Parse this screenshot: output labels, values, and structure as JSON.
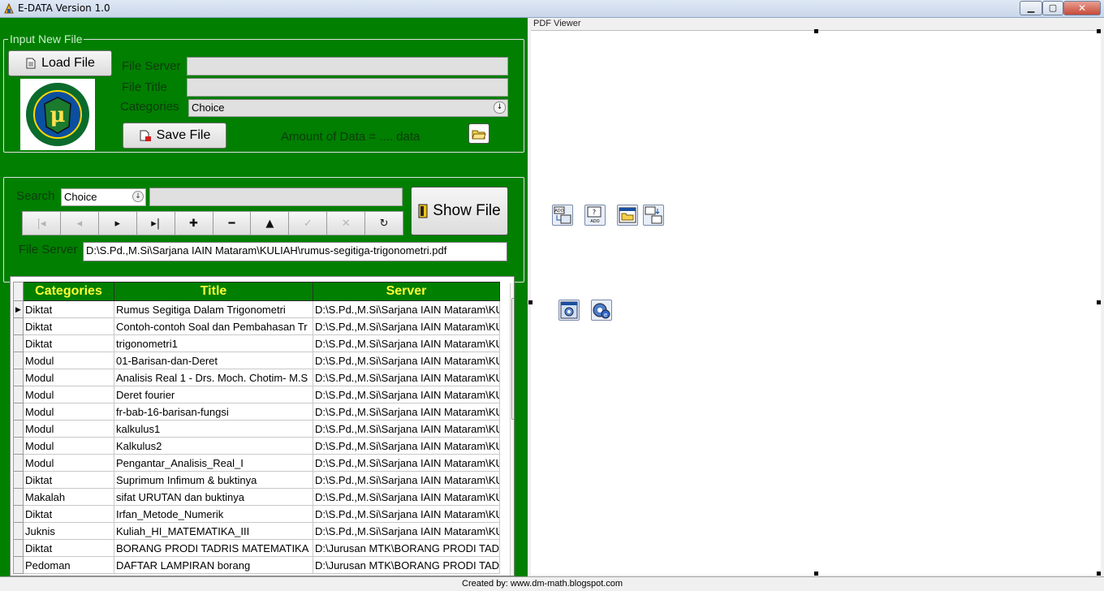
{
  "window": {
    "title": "E-DATA Version 1.0",
    "min_glyph": "▁",
    "max_glyph": "▢",
    "close_glyph": "✕"
  },
  "input_group": {
    "legend": "Input New File",
    "load_button": "Load File",
    "file_server_label": "File Server",
    "file_server_value": "",
    "file_title_label": "File Title",
    "file_title_value": "",
    "categories_label": "Categories",
    "categories_value": "Choice",
    "save_button": "Save File",
    "amount_text": "Amount of Data = .... data"
  },
  "search_group": {
    "search_label": "Search",
    "search_combo_value": "Choice",
    "search_input_value": "",
    "show_button": "Show File",
    "file_server_label": "File Server",
    "file_server_value": "D:\\S.Pd.,M.Si\\Sarjana IAIN Mataram\\KULIAH\\rumus-segitiga-trigonometri.pdf",
    "nav_buttons": [
      {
        "name": "first",
        "glyph": "|◂",
        "enabled": false
      },
      {
        "name": "prior",
        "glyph": "◂",
        "enabled": false
      },
      {
        "name": "next",
        "glyph": "▸",
        "enabled": true
      },
      {
        "name": "last",
        "glyph": "▸|",
        "enabled": true
      },
      {
        "name": "insert",
        "glyph": "✚",
        "enabled": true
      },
      {
        "name": "delete",
        "glyph": "━",
        "enabled": true
      },
      {
        "name": "edit",
        "glyph": "▲",
        "enabled": true
      },
      {
        "name": "post",
        "glyph": "✓",
        "enabled": false
      },
      {
        "name": "cancel",
        "glyph": "✕",
        "enabled": false
      },
      {
        "name": "refresh",
        "glyph": "↻",
        "enabled": true
      }
    ]
  },
  "grid": {
    "columns": [
      "Categories",
      "Title",
      "Server"
    ],
    "rows": [
      [
        "Diktat",
        "Rumus Segitiga Dalam Trigonometri",
        "D:\\S.Pd.,M.Si\\Sarjana IAIN Mataram\\KU"
      ],
      [
        "Diktat",
        "Contoh-contoh Soal dan Pembahasan Tr",
        "D:\\S.Pd.,M.Si\\Sarjana IAIN Mataram\\KU"
      ],
      [
        "Diktat",
        "trigonometri1",
        "D:\\S.Pd.,M.Si\\Sarjana IAIN Mataram\\KU"
      ],
      [
        "Modul",
        "01-Barisan-dan-Deret",
        "D:\\S.Pd.,M.Si\\Sarjana IAIN Mataram\\KU"
      ],
      [
        "Modul",
        "Analisis Real 1 - Drs. Moch. Chotim- M.S",
        "D:\\S.Pd.,M.Si\\Sarjana IAIN Mataram\\KU"
      ],
      [
        "Modul",
        "Deret fourier",
        "D:\\S.Pd.,M.Si\\Sarjana IAIN Mataram\\KU"
      ],
      [
        "Modul",
        "fr-bab-16-barisan-fungsi",
        "D:\\S.Pd.,M.Si\\Sarjana IAIN Mataram\\KU"
      ],
      [
        "Modul",
        "kalkulus1",
        "D:\\S.Pd.,M.Si\\Sarjana IAIN Mataram\\KU"
      ],
      [
        "Modul",
        "Kalkulus2",
        "D:\\S.Pd.,M.Si\\Sarjana IAIN Mataram\\KU"
      ],
      [
        "Modul",
        "Pengantar_Analisis_Real_I",
        "D:\\S.Pd.,M.Si\\Sarjana IAIN Mataram\\KU"
      ],
      [
        "Diktat",
        "Suprimum Infimum & buktinya",
        "D:\\S.Pd.,M.Si\\Sarjana IAIN Mataram\\KU"
      ],
      [
        "Makalah",
        "sifat URUTAN dan buktinya",
        "D:\\S.Pd.,M.Si\\Sarjana IAIN Mataram\\KU"
      ],
      [
        "Diktat",
        "Irfan_Metode_Numerik",
        "D:\\S.Pd.,M.Si\\Sarjana IAIN Mataram\\KU"
      ],
      [
        "Juknis",
        "Kuliah_HI_MATEMATIKA_III",
        "D:\\S.Pd.,M.Si\\Sarjana IAIN Mataram\\KU"
      ],
      [
        "Diktat",
        "BORANG PRODI TADRIS MATEMATIKA",
        "D:\\Jurusan MTK\\BORANG PRODI TAD"
      ],
      [
        "Pedoman",
        "DAFTAR LAMPIRAN borang",
        "D:\\Jurusan MTK\\BORANG PRODI TAD"
      ]
    ],
    "selected_row": 0
  },
  "pdf_viewer": {
    "label": "PDF Viewer",
    "component_icons": [
      "ado-connection-icon",
      "ado-query-icon",
      "open-dialog-icon",
      "data-transfer-icon",
      "app-settings-icon",
      "xp-manifest-icon"
    ]
  },
  "status": {
    "text": "Created by: www.dm-math.blogspot.com"
  }
}
